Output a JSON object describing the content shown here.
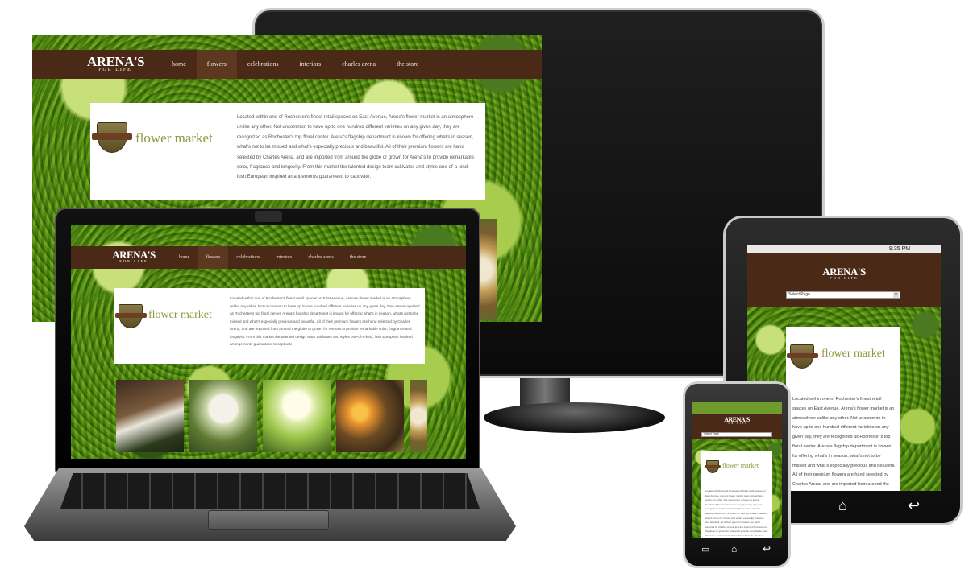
{
  "site": {
    "logo": "ARENA'S",
    "logo_tagline": "FOR LIFE",
    "nav": [
      "home",
      "flowers",
      "celebrations",
      "interiors",
      "charles arena",
      "the store"
    ],
    "active_nav": "flowers",
    "page_title": "flower market",
    "body": "Located within one of Rochester's finest retail spaces on East Avenue, Arena's flower market is an atmosphere unlike any other. Not uncommon to have up to one hundred different varieties on any given day, they are recognized as Rochester's top floral center. Arena's flagship department is known for offering what's in season, what's not to be missed and what's especially precious and beautiful. All of their premium flowers are hand selected by Charles Arena, and are imported from around the globe or grown for Arena's to provide remarkable color, fragrance and longevity. From this market the talented design team cultivates and styles one-of-a-kind, lush European inspired arrangements guaranteed to captivate.",
    "select_placeholder": "Select Page"
  },
  "tablet": {
    "status_time": "9:35 PM",
    "tablet_body": "Located within one of Rochester's finest retail spaces on East Avenue, Arena's flower market is an atmosphere unlike any other. Not uncommon to have up to one hundred different varieties on any given day, they are recognized as Rochester's top floral center. Arena's flagship department is known for offering what's in season, what's not to be missed and what's especially precious and beautiful. All of their premium flowers are hand selected by Charles Arena, and are imported from around the globe or grown for Arena's to provide remarkable color, fragrance and longevity. From this market the"
  },
  "icons": {
    "monitor_power": "power-icon",
    "tablet_home": "home-icon",
    "tablet_back": "back-icon",
    "phone_recent": "recent-apps-icon",
    "phone_home": "home-icon",
    "phone_back": "back-icon"
  },
  "colors": {
    "nav_bg": "#4a2a17",
    "nav_active": "#5c3820",
    "title_green": "#8d9a3c",
    "foliage": "#6f9a2c"
  }
}
